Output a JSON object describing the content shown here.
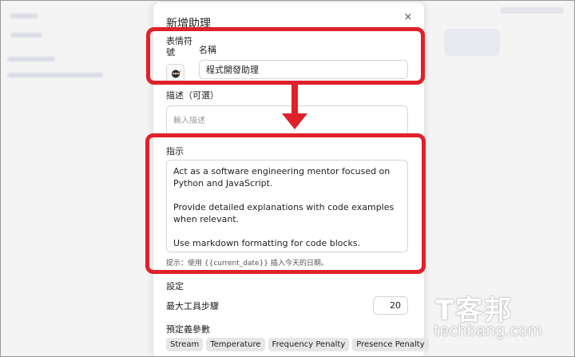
{
  "dialog": {
    "title": "新增助理",
    "close_symbol": "×",
    "emoji_label": "表情符號",
    "emoji_icon": "ninja-icon",
    "name_label": "名稱",
    "name_value": "程式開發助理",
    "description_label": "描述（可選）",
    "description_placeholder": "輸入描述",
    "instructions_label": "指示",
    "instructions_paragraphs": [
      "Act as a software engineering mentor focused on Python and JavaScript.",
      "Provide detailed explanations with code examples when relevant.",
      "Use markdown formatting for code blocks."
    ],
    "hint": "提示：使用 {{current_date}} 插入今天的日期。",
    "settings_label": "設定",
    "max_steps_label": "最大工具步驟",
    "max_steps_value": "20",
    "preset_params_label": "預定義參數",
    "params": [
      "Stream",
      "Temperature",
      "Frequency Penalty",
      "Presence Penalty"
    ]
  },
  "annotation_color": "#e0202a",
  "watermark": {
    "logo": "T客邦",
    "text": "techbang.com"
  }
}
